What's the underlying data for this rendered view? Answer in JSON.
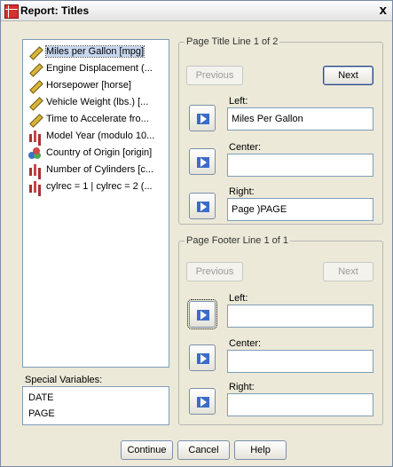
{
  "window": {
    "title": "Report: Titles",
    "close_glyph": "x"
  },
  "variables": [
    {
      "label": "Miles per Gallon [mpg]",
      "icon": "scale-ruler-icon",
      "selected": true
    },
    {
      "label": "Engine Displacement (...",
      "icon": "scale-ruler-icon"
    },
    {
      "label": "Horsepower [horse]",
      "icon": "scale-ruler-icon"
    },
    {
      "label": "Vehicle Weight (lbs.) [...",
      "icon": "scale-ruler-icon"
    },
    {
      "label": "Time to Accelerate fro...",
      "icon": "scale-ruler-icon"
    },
    {
      "label": "Model Year (modulo 10...",
      "icon": "ordinal-bar-icon"
    },
    {
      "label": "Country of Origin [origin]",
      "icon": "nominal-circles-icon"
    },
    {
      "label": "Number of Cylinders [c...",
      "icon": "ordinal-bar-icon"
    },
    {
      "label": "cylrec = 1 | cylrec = 2 (...",
      "icon": "ordinal-bar-icon"
    }
  ],
  "special_variables": {
    "label": "Special Variables:",
    "items": [
      "DATE",
      "PAGE"
    ]
  },
  "title_group": {
    "legend": "Page Title Line 1 of 2",
    "previous": "Previous",
    "next": "Next",
    "left_label": "Left:",
    "left_value": "Miles Per Gallon",
    "center_label": "Center:",
    "center_value": "",
    "right_label": "Right:",
    "right_value": "Page )PAGE"
  },
  "footer_group": {
    "legend": "Page Footer Line 1 of 1",
    "previous": "Previous",
    "next": "Next",
    "left_label": "Left:",
    "left_value": "",
    "center_label": "Center:",
    "center_value": "",
    "right_label": "Right:",
    "right_value": ""
  },
  "buttons": {
    "continue": "Continue",
    "cancel": "Cancel",
    "help": "Help"
  }
}
